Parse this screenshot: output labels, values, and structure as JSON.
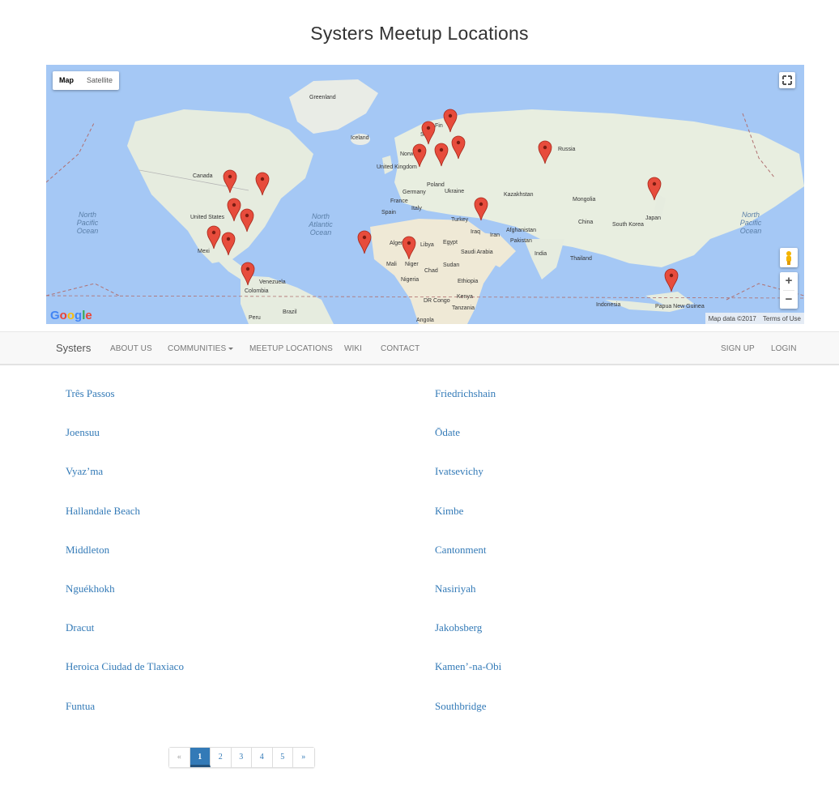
{
  "page": {
    "title": "Systers Meetup Locations"
  },
  "map": {
    "type_control": {
      "map_label": "Map",
      "satellite_label": "Satellite"
    },
    "google_logo": "Google",
    "attribution": {
      "data_label": "Map data ©2017",
      "terms_label": "Terms of Use"
    },
    "labels": {
      "greenland": "Greenland",
      "iceland": "Iceland",
      "finland": "Fin",
      "sweden": "S",
      "norway": "Norway",
      "uk": "United Kingdom",
      "germany": "Germany",
      "poland": "Poland",
      "ukraine": "Ukraine",
      "france": "France",
      "spain": "Spain",
      "italy": "Italy",
      "turkey": "Turkey",
      "iraq": "Iraq",
      "iran": "Iran",
      "russia": "Russia",
      "kazakhstan": "Kazakhstan",
      "mongolia": "Mongolia",
      "china": "China",
      "south_korea": "South Korea",
      "japan": "Japan",
      "afghanistan": "Afghanistan",
      "pakistan": "Pakistan",
      "india": "India",
      "thailand": "Thailand",
      "indonesia": "Indonesia",
      "png": "Papua New Guinea",
      "canada": "Canada",
      "united_states": "United States",
      "mexico": "Mexi",
      "venezuela": "Venezuela",
      "colombia": "Colombia",
      "peru": "Peru",
      "brazil": "Brazil",
      "algeria": "Algeria",
      "libya": "Libya",
      "egypt": "Egypt",
      "saudi": "Saudi Arabia",
      "mali": "Mali",
      "niger": "Niger",
      "chad": "Chad",
      "sudan": "Sudan",
      "nigeria": "Nigeria",
      "ethiopia": "Ethiopia",
      "kenya": "Kenya",
      "tanzania": "Tanzania",
      "dr_congo": "DR Congo",
      "angola": "Angola",
      "n_atlantic": "North Atlantic Ocean",
      "n_pacific_left": "North Pacific Ocean",
      "n_pacific_right": "North Pacific Ocean"
    }
  },
  "navbar": {
    "brand": "Systers",
    "items": [
      {
        "label": "ABOUT US"
      },
      {
        "label": "COMMUNITIES"
      },
      {
        "label": "MEETUP LOCATIONS"
      },
      {
        "label": "WIKI"
      },
      {
        "label": "CONTACT"
      }
    ],
    "right": [
      {
        "label": "SIGN UP"
      },
      {
        "label": "LOGIN"
      }
    ]
  },
  "locations": {
    "left": [
      "Três Passos",
      "Joensuu",
      "Vyaz’ma",
      "Hallandale Beach",
      "Middleton",
      "Nguékhokh",
      "Dracut",
      "Heroica Ciudad de Tlaxiaco",
      "Funtua"
    ],
    "right": [
      "Friedrichshain",
      "Ōdate",
      "Ivatsevichy",
      "Kimbe",
      "Cantonment",
      "Nasiriyah",
      "Jakobsberg",
      "Kamen’-na-Obi",
      "Southbridge"
    ]
  },
  "pagination": {
    "prev": "«",
    "pages": [
      "1",
      "2",
      "3",
      "4",
      "5"
    ],
    "next": "»",
    "active": "1"
  },
  "colors": {
    "link": "#337ab7",
    "water": "#a5c8f5",
    "land": "#e8eee0",
    "marker": "#e74c3c"
  }
}
